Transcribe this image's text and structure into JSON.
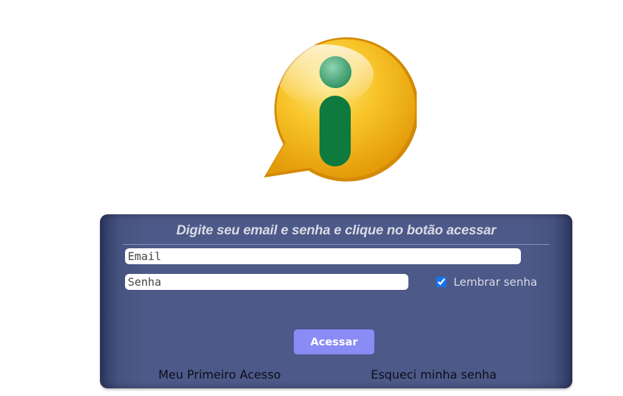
{
  "logo": {
    "icon": "info-icon",
    "colors": {
      "bubble": "#f5b815",
      "letter": "#0e7a3e"
    }
  },
  "login": {
    "title": "Digite seu email e senha e clique no botão acessar",
    "email_placeholder": "Email",
    "password_placeholder": "Senha",
    "remember_label": "Lembrar senha",
    "remember_checked": true,
    "submit_label": "Acessar",
    "first_access_link": "Meu Primeiro Acesso",
    "forgot_password_link": "Esqueci minha senha",
    "colors": {
      "panel": "#4d5988",
      "button": "#8b8bf6",
      "title": "#d9dbe6"
    }
  }
}
